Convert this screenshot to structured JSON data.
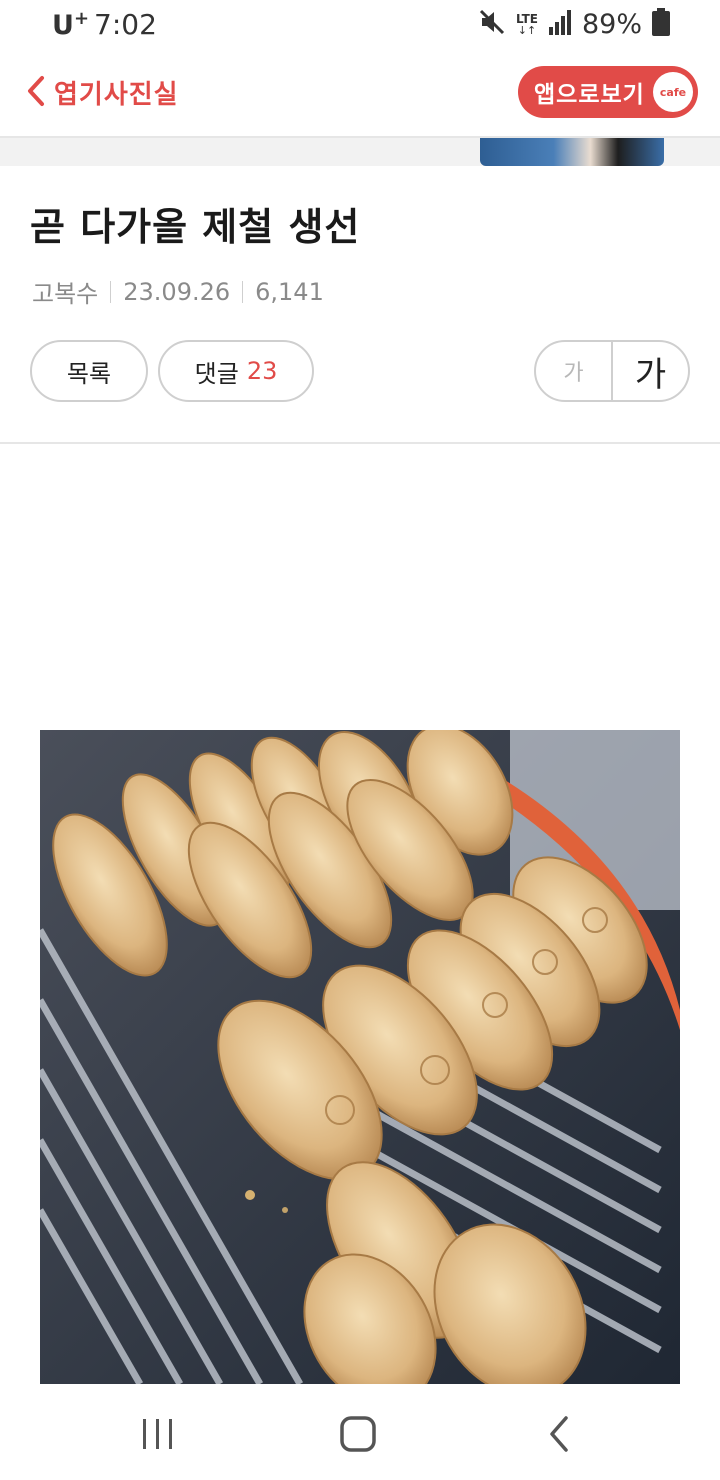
{
  "status_bar": {
    "carrier": "U",
    "carrier_sup": "+",
    "time": "7:02",
    "network": "LTE",
    "battery": "89%"
  },
  "header": {
    "back_label": "엽기사진실",
    "app_button_label": "앱으로보기",
    "cafe_badge": "cafe"
  },
  "article": {
    "title": "곧 다가올 제철 생선",
    "author": "고복수",
    "date": "23.09.26",
    "views": "6,141",
    "list_button": "목록",
    "comment_label": "댓글",
    "comment_count": "23",
    "font_small": "가",
    "font_large": "가"
  },
  "colors": {
    "accent": "#e14b48",
    "divider": "#e6e6e6",
    "meta_text": "#8a8a8a"
  },
  "icons": {
    "back": "chevron-left-icon",
    "mute": "mute-icon",
    "signal": "signal-icon",
    "battery": "battery-icon",
    "nav_recent": "recent-apps-icon",
    "nav_home": "home-icon",
    "nav_back": "back-icon"
  }
}
